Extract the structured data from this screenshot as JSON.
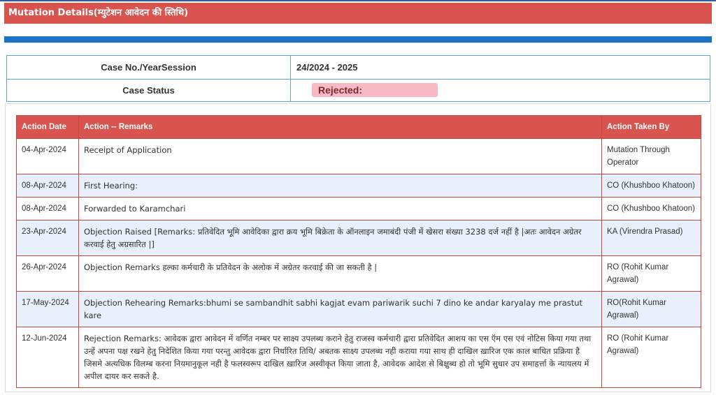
{
  "header": {
    "title": "Mutation Details(म्युटेशन आवेदन की स्तिथि)"
  },
  "case": {
    "number_label": "Case No./YearSession",
    "number_value": "24/2024 - 2025",
    "status_label": "Case Status",
    "status_value": "Rejected:"
  },
  "colors": {
    "header": "#d9534f",
    "bar": "#1d73c4",
    "alt_row": "#e8f1fb",
    "status_bg": "#f8b9c4"
  },
  "table": {
    "columns": [
      "Action Date",
      "Action -- Remarks",
      "Action Taken By"
    ],
    "rows": [
      {
        "date": "04-Apr-2024",
        "remarks": "Receipt of Application",
        "by": "Mutation Through Operator"
      },
      {
        "date": "08-Apr-2024",
        "remarks": "First Hearing:",
        "by": "CO (Khushboo Khatoon)"
      },
      {
        "date": "08-Apr-2024",
        "remarks": "Forwarded to Karamchari",
        "by": "CO (Khushboo Khatoon)"
      },
      {
        "date": "23-Apr-2024",
        "remarks": "Objection Raised [Remarks: प्रतिवेदित भूमि आवेदिका द्वारा क्रय भूमि बिक्रेता के ऑनलाइन जमाबंदी पंजी में खेसरा संख्या 3238 दर्ज नहीं है |अतः आवेदन अग्रेतर करवाई हेतु अग्रसारित |]",
        "by": "KA (Virendra Prasad)"
      },
      {
        "date": "26-Apr-2024",
        "remarks": "Objection Remarks हल्का कर्मचारी के प्रतिवेदन के अलोक में अग्रेतर करवाई की जा सकती है |",
        "by": "RO (Rohit Kumar Agrawal)"
      },
      {
        "date": "17-May-2024",
        "remarks": "Objection Rehearing Remarks:bhumi se sambandhit sabhi kagjat evam pariwarik suchi 7 dino ke andar karyalay me prastut kare",
        "by": "RO(Rohit Kumar Agrawal)"
      },
      {
        "date": "12-Jun-2024",
        "remarks": "Rejection Remarks: आवेदक द्वारा आवेदन में वर्णित नम्बर पर साक्ष्य उपलब्ध कराने हेतु राजस्व कर्मचारी द्वारा प्रतिवेदित आशय का एस ऍम एस एवं नोटिस किया गया तथा उन्हें अपना पक्ष रखने हेतु निदेशित किया गया परन्तु आवेदक द्वारा निर्धारित तिथि/ अबतक साक्ष्य उपलब्ध नही कराया गया साथ ही दाखिल ख़ारिज एक काल बाधित प्रक्रिया है जिसमे अत्यधिक विलम्ब करना नियमानुकूल नही है फलस्वरूप दाखिल ख़ारिज अस्वीकृत किया जाता है, आवेदक आदेश से बिक्षुब्ध हो तो भूमि सुधार उप समाहर्त्ता के न्यायलय में अपील दायर कर सकते है.",
        "by": "RO (Rohit Kumar Agrawal)"
      }
    ]
  }
}
